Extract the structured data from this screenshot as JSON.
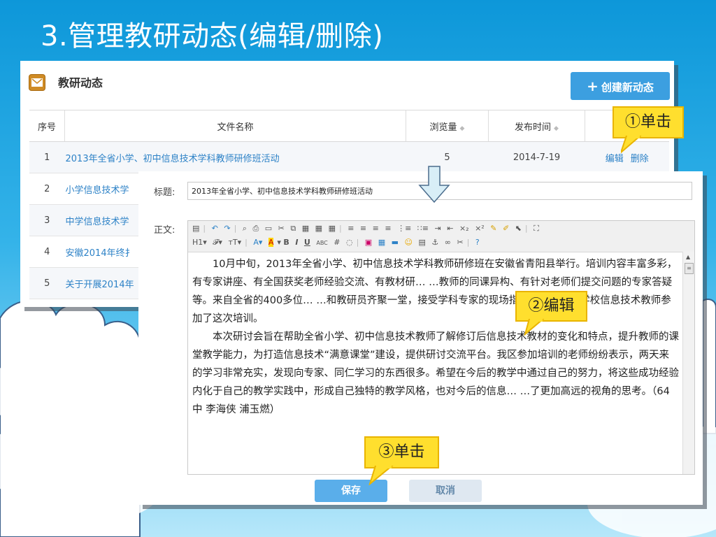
{
  "slide": {
    "title": "3.管理教研动态(编辑/删除)"
  },
  "list_panel": {
    "title": "教研动态",
    "create_button": "创建新动态",
    "columns": {
      "no": "序号",
      "name": "文件名称",
      "views": "浏览量",
      "date": "发布时间"
    },
    "rows": [
      {
        "no": "1",
        "name": "2013年全省小学、初中信息技术学科教师研修班活动",
        "views": "5",
        "date": "2014-7-19",
        "edit": "编辑",
        "delete": "删除"
      },
      {
        "no": "2",
        "name": "小学信息技术学",
        "views": "",
        "date": "",
        "edit": "",
        "delete": ""
      },
      {
        "no": "3",
        "name": "中学信息技术学",
        "views": "",
        "date": "",
        "edit": "",
        "delete": ""
      },
      {
        "no": "4",
        "name": "安徽2014年终扌",
        "views": "",
        "date": "",
        "edit": "",
        "delete": ""
      },
      {
        "no": "5",
        "name": "关于开展2014年",
        "views": "",
        "date": "",
        "edit": "",
        "delete": ""
      }
    ]
  },
  "edit_panel": {
    "title_label": "标题:",
    "title_value": "2013年全省小学、初中信息技术学科教师研修班活动",
    "body_label": "正文:",
    "toolbar": {
      "row1": [
        "源码",
        "撤销",
        "重做",
        "预览",
        "打印",
        "模板",
        "剪切",
        "复制",
        "粘贴",
        "纯文本粘贴",
        "Word粘贴",
        "左对齐",
        "居中",
        "右对齐",
        "两端对齐",
        "编号",
        "项目符号",
        "增加缩进",
        "减少缩进",
        "下标",
        "上标",
        "清除格式",
        "格式刷",
        "全选",
        "全屏"
      ],
      "row2": [
        "H1▾",
        "𝓕▾",
        "тT▾",
        "A▾",
        "A▾",
        "B",
        "I",
        "U",
        "ABC",
        "#",
        "◌",
        "图片",
        "表格",
        "分隔线",
        "表情",
        "分页",
        "锚点",
        "链接",
        "取消链接",
        "帮助"
      ]
    },
    "body": [
      "10月中旬，2013年全省小学、初中信息技术学科教师研修班在安徽省青阳县举行。培训内容丰富多彩，有专家讲座、有全国获奖老师经验交流、有教材研… …教师的同课异构、有针对老师们提交问题的专家答疑等。来自全省的400多位… …和教研员齐聚一堂，接受学科专家的现场指导。我区部分学校信息技术教师参加了这次培训。",
      "本次研讨会旨在帮助全省小学、初中信息技术教师了解修订后信息技术教材的变化和特点，提升教师的课堂教学能力，为打造信息技术“满意课堂”建设，提供研讨交流平台。我区参加培训的老师纷纷表示，两天来的学习非常充实，发现向专家、同仁学习的东西很多。希望在今后的教学中通过自己的努力，将这些成功经验内化于自己的教学实践中，形成自己独特的教学风格，也对今后的信息… …了更加高远的视角的思考。（64中 李海侠 浦玉燃）"
    ],
    "save_button": "保存",
    "cancel_button": "取消"
  },
  "callouts": {
    "step1": "①单击",
    "step2": "②编辑",
    "step3": "③单击"
  },
  "colors": {
    "accent": "#3c9fe0",
    "link": "#2d82c7",
    "callout": "#ffdf2e"
  }
}
